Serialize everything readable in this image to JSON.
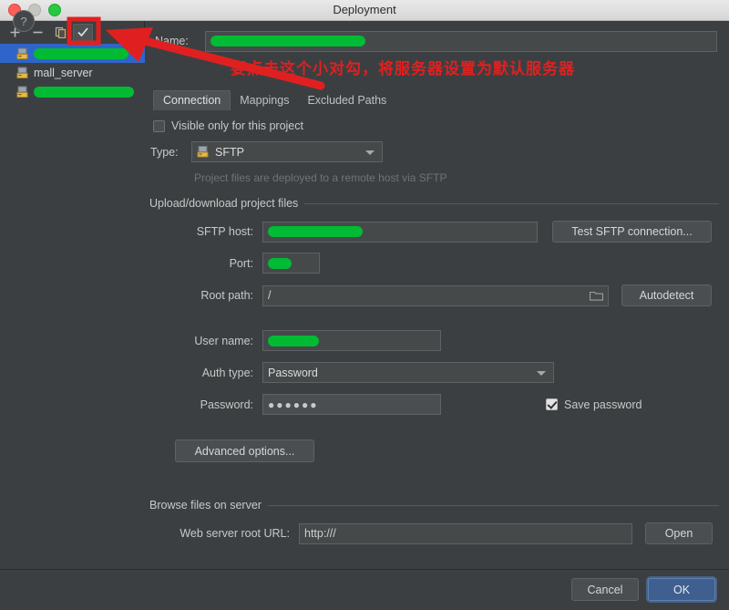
{
  "window": {
    "title": "Deployment",
    "traffic_lights": [
      "close-button",
      "minimize-button",
      "zoom-button"
    ]
  },
  "sidebar": {
    "toolbar": [
      {
        "name": "add-server-button",
        "glyph": "+"
      },
      {
        "name": "remove-server-button",
        "glyph": "−"
      },
      {
        "name": "copy-server-button",
        "glyph": "copy-icon"
      },
      {
        "name": "set-default-server-button",
        "glyph": "check-icon"
      }
    ],
    "items": [
      {
        "label": "",
        "redacted": true,
        "selected": true,
        "redact_width": 104
      },
      {
        "label": "mall_server",
        "redacted": false,
        "selected": false,
        "redact_width": 0
      },
      {
        "label": "",
        "redacted": true,
        "selected": false,
        "redact_width": 110
      }
    ]
  },
  "form": {
    "name_label": "Name:",
    "name_value": "",
    "name_redacted": true,
    "tabs": [
      {
        "label": "Connection",
        "active": true
      },
      {
        "label": "Mappings",
        "active": false
      },
      {
        "label": "Excluded Paths",
        "active": false
      }
    ],
    "visible_only_label": "Visible only for this project",
    "visible_only_checked": false,
    "type_label": "Type:",
    "type_value": "SFTP",
    "type_hint": "Project files are deployed to a remote host via SFTP",
    "group_upload": "Upload/download project files",
    "sftp_host_label": "SFTP host:",
    "sftp_host_value": "",
    "sftp_host_redacted": true,
    "test_connection_button": "Test SFTP connection...",
    "port_label": "Port:",
    "port_value": "",
    "port_redacted": true,
    "root_path_label": "Root path:",
    "root_path_value": "/",
    "autodetect_button": "Autodetect",
    "user_name_label": "User name:",
    "user_name_value": "",
    "user_name_redacted": true,
    "auth_type_label": "Auth type:",
    "auth_type_value": "Password",
    "password_label": "Password:",
    "password_value": "●●●●●●",
    "save_password_label": "Save password",
    "save_password_checked": true,
    "advanced_options_button": "Advanced options...",
    "group_browse": "Browse files on server",
    "web_root_label": "Web server root URL:",
    "web_root_value": "http:///",
    "open_button": "Open"
  },
  "footer": {
    "help_glyph": "?",
    "cancel_label": "Cancel",
    "ok_label": "OK"
  },
  "annotation": {
    "note_text": "要点击这个小对勾，将服务器设置为默认服务器",
    "highlight_color": "#e02020",
    "redaction_color": "#00bb33"
  }
}
